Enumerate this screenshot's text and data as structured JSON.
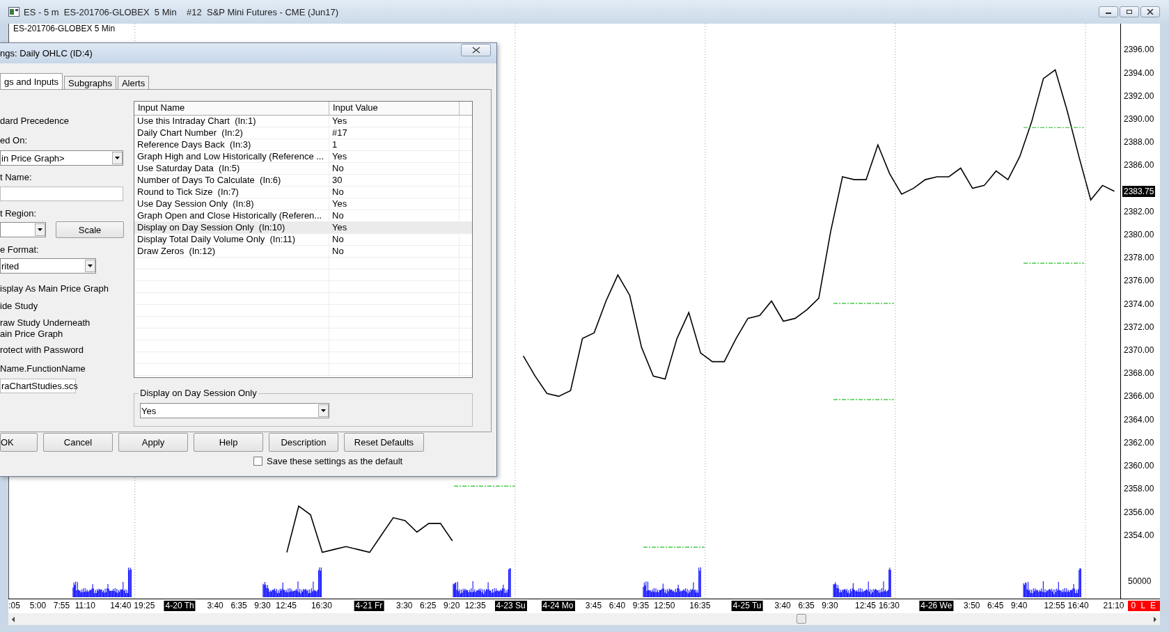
{
  "window": {
    "title": "ES - 5 m  ES-201706-GLOBEX  5 Min    #12  S&P Mini Futures - CME (Jun17)"
  },
  "chart": {
    "label": "ES-201706-GLOBEX 5 Min",
    "chart_data": {
      "type": "line",
      "ylim": [
        2348.5,
        2398.25
      ],
      "yticks": [
        {
          "value": 2396,
          "label": "2396.00"
        },
        {
          "value": 2394,
          "label": "2394.00"
        },
        {
          "value": 2392,
          "label": "2392.00"
        },
        {
          "value": 2390,
          "label": "2390.00"
        },
        {
          "value": 2388,
          "label": "2388.00"
        },
        {
          "value": 2386,
          "label": "2386.00"
        },
        {
          "value": 2382,
          "label": "2382.00"
        },
        {
          "value": 2380,
          "label": "2380.00"
        },
        {
          "value": 2378,
          "label": "2378.00"
        },
        {
          "value": 2376,
          "label": "2376.00"
        },
        {
          "value": 2374,
          "label": "2374.00"
        },
        {
          "value": 2372,
          "label": "2372.00"
        },
        {
          "value": 2370,
          "label": "2370.00"
        },
        {
          "value": 2368,
          "label": "2368.00"
        },
        {
          "value": 2366,
          "label": "2366.00"
        },
        {
          "value": 2364,
          "label": "2364.00"
        },
        {
          "value": 2362,
          "label": "2362.00"
        },
        {
          "value": 2360,
          "label": "2360.00"
        },
        {
          "value": 2358,
          "label": "2358.00"
        },
        {
          "value": 2356,
          "label": "2356.00"
        },
        {
          "value": 2354,
          "label": "2354.00"
        }
      ],
      "categories": [
        ":05",
        null,
        "5:00",
        null,
        "7:55",
        null,
        "11:10",
        null,
        null,
        "14:40",
        null,
        "19:25",
        null,
        null,
        "4-20 Th",
        null,
        null,
        "3:40",
        null,
        "6:35",
        null,
        "9:30",
        null,
        "12:45",
        null,
        null,
        "16:30",
        null,
        null,
        null,
        "4-21 Fr",
        null,
        null,
        "3:30",
        null,
        "6:25",
        null,
        "9:20",
        null,
        "12:35",
        null,
        null,
        "4-23 Su",
        null,
        null,
        null,
        "4-24 Mo",
        null,
        null,
        "3:45",
        null,
        "6:40",
        null,
        "9:35",
        null,
        "12:50",
        null,
        null,
        "16:35",
        null,
        null,
        null,
        "4-25 Tu",
        null,
        null,
        "3:40",
        null,
        "6:35",
        null,
        "9:30",
        null,
        null,
        "12:45",
        null,
        "16:30",
        null,
        null,
        null,
        "4-26 We",
        null,
        null,
        "3:50",
        null,
        "6:45",
        null,
        "9:40",
        null,
        null,
        "12:55",
        null,
        "16:40",
        null,
        null,
        "21:10"
      ],
      "series": [
        {
          "color": "#000000",
          "values": [
            null,
            null,
            null,
            null,
            null,
            null,
            null,
            null,
            null,
            null,
            null,
            null,
            null,
            null,
            null,
            null,
            null,
            null,
            null,
            null,
            null,
            null,
            null,
            2352.5,
            2356.5,
            2355.75,
            2352.5,
            2352.75,
            2353,
            2352.75,
            2352.5,
            2354,
            2355.5,
            2355.25,
            2354.25,
            2355,
            2355,
            2353.5,
            null,
            null,
            null,
            null,
            null,
            2369.5,
            2367.75,
            2366.25,
            2366,
            2366.5,
            2371,
            2371.5,
            2374.25,
            2376.5,
            2374.75,
            2370.25,
            2367.75,
            2367.5,
            2371,
            2373.25,
            2369.75,
            2369,
            2369,
            2371,
            2372.75,
            2373,
            2374.25,
            2372.5,
            2372.75,
            2373.5,
            2374.5,
            2380.25,
            2385,
            2384.75,
            2384.75,
            2387.75,
            2385.25,
            2383.5,
            2384,
            2384.75,
            2385,
            2385,
            2385.75,
            2384,
            2384.25,
            2385.5,
            2384.75,
            2386.75,
            2389.75,
            2393.5,
            2394.25,
            2390.75,
            2386.75,
            2383,
            2384.25,
            2383.75
          ]
        }
      ]
    },
    "time_label_highlighted": [
      false,
      false,
      false,
      false,
      false,
      false,
      true,
      false,
      false,
      false,
      false,
      false,
      true,
      false,
      false,
      false,
      false,
      true,
      true,
      false,
      false,
      false,
      false,
      false,
      true,
      false,
      false,
      false,
      false,
      false,
      true,
      false,
      false,
      false,
      false,
      false,
      false
    ],
    "last_price": "2383.75",
    "volume_label": "50000",
    "status_badge": "0 L E"
  },
  "dialog": {
    "title": "ngs: Daily OHLC (ID:4)",
    "tabs": [
      {
        "label": "gs and Inputs",
        "selected": true
      },
      {
        "label": "Subgraphs",
        "selected": false
      },
      {
        "label": "Alerts",
        "selected": false
      }
    ],
    "left_items": [
      {
        "kind": "label",
        "text": "dard Precedence"
      },
      {
        "kind": "label",
        "text": "ed On:"
      },
      {
        "kind": "select",
        "value": "in Price Graph>"
      },
      {
        "kind": "label",
        "text": "t Name:"
      },
      {
        "kind": "field"
      },
      {
        "kind": "label",
        "text": "t Region:"
      },
      {
        "kind": "select-button",
        "button": "Scale"
      },
      {
        "kind": "label",
        "text": "e Format:"
      },
      {
        "kind": "select",
        "value": "rited"
      },
      {
        "kind": "label",
        "text": "isplay As Main Price Graph"
      },
      {
        "kind": "label",
        "text": "ide Study"
      },
      {
        "kind": "label",
        "text": "raw Study Underneath\nain Price Graph"
      },
      {
        "kind": "label",
        "text": "rotect with Password"
      },
      {
        "kind": "label",
        "text": "Name.FunctionName"
      },
      {
        "kind": "field",
        "value": "raChartStudies.scs"
      }
    ],
    "table": {
      "columns": [
        "Input Name",
        "Input Value"
      ],
      "rows": [
        {
          "name": "Use this Intraday Chart  (In:1)",
          "value": "Yes",
          "selected": false
        },
        {
          "name": "Daily Chart Number  (In:2)",
          "value": "#17",
          "selected": false
        },
        {
          "name": "Reference Days Back  (In:3)",
          "value": "1",
          "selected": false
        },
        {
          "name": "Graph High and Low Historically (Reference ...",
          "value": "Yes",
          "selected": false
        },
        {
          "name": "Use Saturday Data  (In:5)",
          "value": "No",
          "selected": false
        },
        {
          "name": "Number of Days To Calculate  (In:6)",
          "value": "30",
          "selected": false
        },
        {
          "name": "Round to Tick Size  (In:7)",
          "value": "No",
          "selected": false
        },
        {
          "name": "Use Day Session Only  (In:8)",
          "value": "Yes",
          "selected": false
        },
        {
          "name": "Graph Open and Close Historically (Referen...",
          "value": "No",
          "selected": false
        },
        {
          "name": "Display on Day Session Only  (In:10)",
          "value": "Yes",
          "selected": true
        },
        {
          "name": "Display Total Daily Volume Only  (In:11)",
          "value": "No",
          "selected": false
        },
        {
          "name": "Draw Zeros  (In:12)",
          "value": "No",
          "selected": false
        }
      ]
    },
    "group": {
      "title": "Display on Day Session Only",
      "value": "Yes"
    },
    "buttons": [
      "OK",
      "Cancel",
      "Apply",
      "Help",
      "Description",
      "Reset Defaults"
    ],
    "default_checkbox": {
      "label": "Save these settings as the default",
      "checked": false
    }
  }
}
